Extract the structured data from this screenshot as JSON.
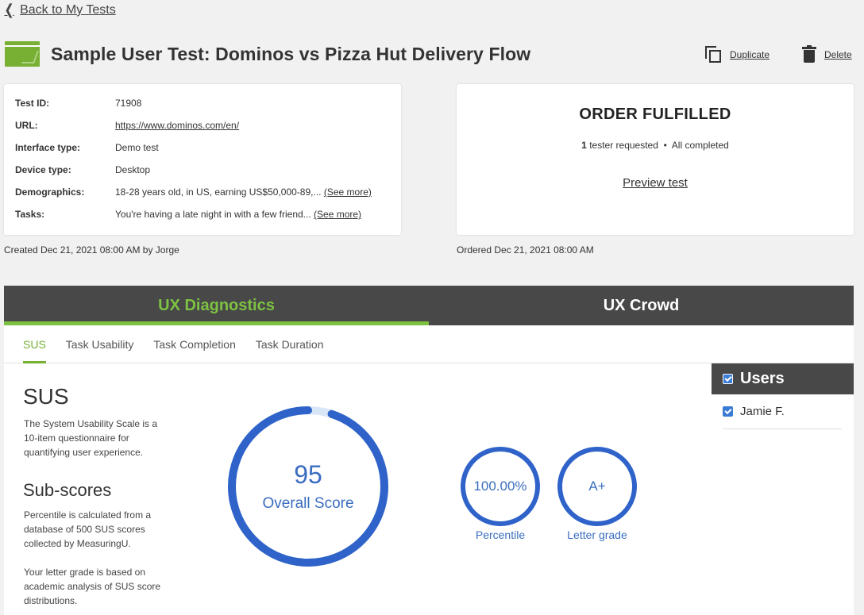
{
  "nav": {
    "back_label": "Back to My Tests"
  },
  "header": {
    "title": "Sample User Test: Dominos vs Pizza Hut Delivery Flow",
    "duplicate_label": "Duplicate",
    "delete_label": "Delete"
  },
  "info": {
    "rows": [
      {
        "label": "Test ID:",
        "value": "71908"
      },
      {
        "label": "URL:",
        "value": "https://www.dominos.com/en/"
      },
      {
        "label": "Interface type:",
        "value": "Demo test"
      },
      {
        "label": "Device type:",
        "value": "Desktop"
      },
      {
        "label": "Demographics:",
        "value": "18-28 years old, in US, earning US$50,000-89,...",
        "more": "(See more)"
      },
      {
        "label": "Tasks:",
        "value": "You're having a late night in with a few friend...",
        "more": "(See more)"
      }
    ],
    "created": "Created Dec 21, 2021 08:00 AM by Jorge"
  },
  "status": {
    "title": "ORDER FULFILLED",
    "tester_count": "1",
    "tester_text": "tester requested",
    "separator": "•",
    "completed_text": "All completed",
    "preview_label": "Preview test",
    "ordered": "Ordered Dec 21, 2021 08:00 AM"
  },
  "tabs": {
    "main": [
      "UX Diagnostics",
      "UX Crowd"
    ],
    "active_main": "UX Diagnostics",
    "sub": [
      "SUS",
      "Task Usability",
      "Task Completion",
      "Task Duration"
    ],
    "active_sub": "SUS"
  },
  "sus": {
    "title": "SUS",
    "description": "The System Usability Scale is a 10-item questionnaire for quantifying user experience.",
    "subscores_title": "Sub-scores",
    "subscores_desc1": "Percentile is calculated from a database of 500 SUS scores collected by MeasuringU.",
    "subscores_desc2": "Your letter grade is based on academic analysis of SUS score distributions.",
    "overall_score": "95",
    "overall_label": "Overall Score",
    "overall_fraction": 0.95,
    "percentile": "100.00%",
    "percentile_label": "Percentile",
    "grade": "A+",
    "grade_label": "Letter grade"
  },
  "users": {
    "title": "Users",
    "list": [
      "Jamie F."
    ]
  },
  "colors": {
    "accent_green": "#7dc242",
    "gauge_blue": "#2f63c9",
    "gauge_track": "#d8e6f7",
    "dark_bar": "#484848"
  },
  "icons": {
    "back": "chevron-left-icon",
    "test": "test-card-icon",
    "duplicate": "copy-icon",
    "delete": "trash-icon",
    "checkbox": "checkbox-checked-icon"
  }
}
